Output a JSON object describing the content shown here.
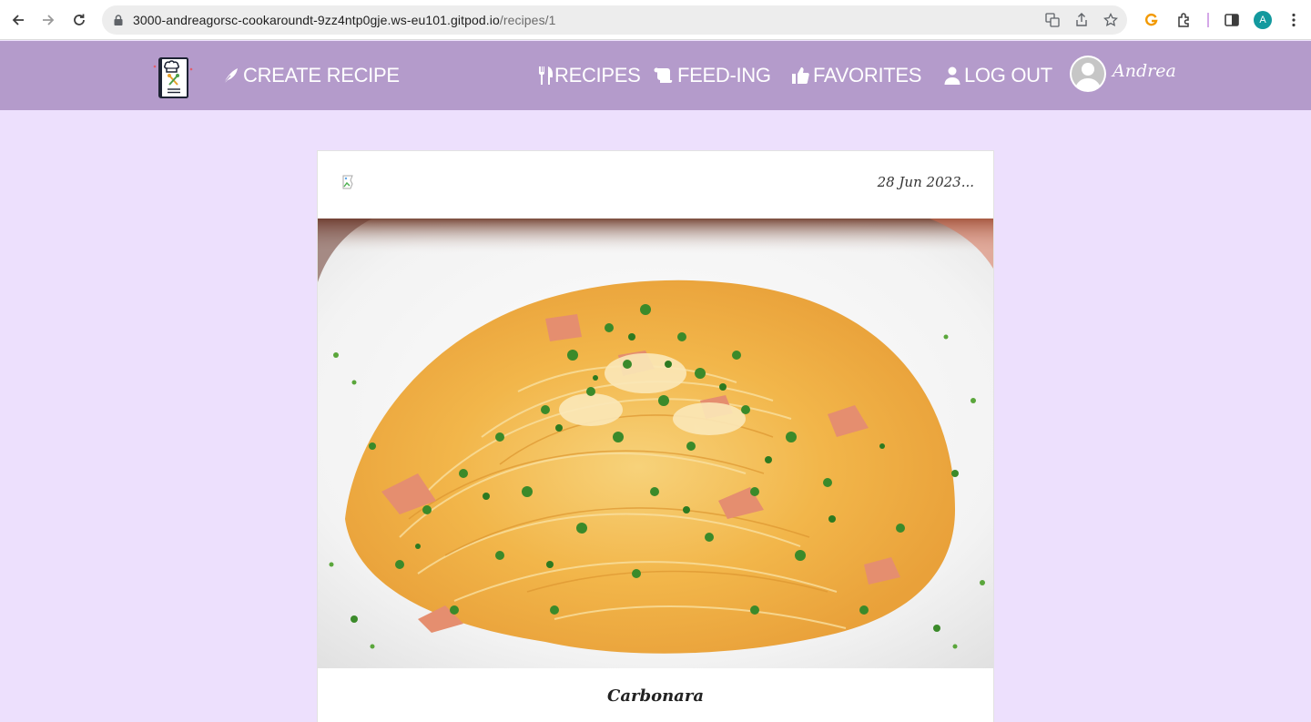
{
  "browser": {
    "url_host": "3000-andreagorsc-cookaroundt-9zz4ntp0gje.ws-eu101.gitpod.io",
    "url_path": "/recipes/1",
    "profile_initial": "A"
  },
  "nav": {
    "create_recipe": "CREATE RECIPE",
    "recipes": "RECIPES",
    "feeding": "FEED-ING",
    "favorites": "FAVORITES",
    "log_out": "LOG OUT",
    "username": "Andrea"
  },
  "post": {
    "date": "28 Jun 2023...",
    "title": "Carbonara"
  },
  "colors": {
    "header": "#b49bcb",
    "page_background": "#ede0fd"
  }
}
